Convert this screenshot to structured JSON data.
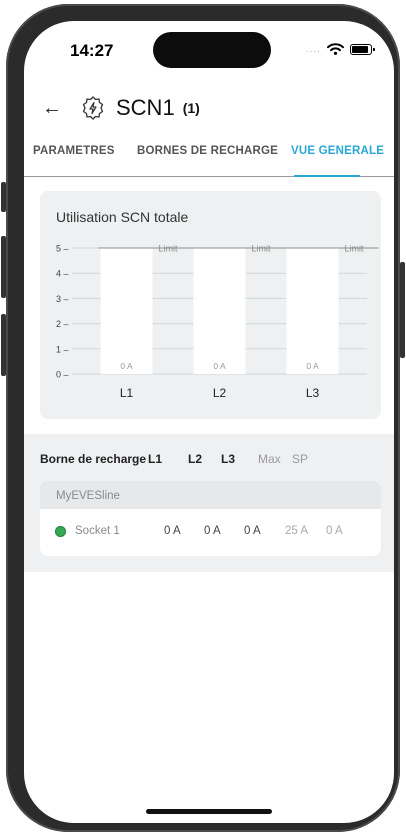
{
  "status_bar": {
    "time": "14:27",
    "signal_dots": "....",
    "wifi_icon": "wifi-icon",
    "battery_icon": "battery-icon"
  },
  "header": {
    "back_icon": "arrow-left-icon",
    "device_icon": "ev-charger-icon",
    "title": "SCN1",
    "count": "(1)"
  },
  "tabs": [
    {
      "label": "PARAMETRES",
      "active": false
    },
    {
      "label": "BORNES DE RECHARGE",
      "active": false
    },
    {
      "label": "VUE GENERALE",
      "active": true
    }
  ],
  "accent_color": "#29a7d6",
  "chart": {
    "title": "Utilisation SCN totale"
  },
  "chart_data": {
    "type": "bar",
    "title": "Utilisation SCN totale",
    "categories": [
      "L1",
      "L2",
      "L3"
    ],
    "values": [
      0,
      0,
      0
    ],
    "value_labels": [
      "0 A",
      "0 A",
      "0 A"
    ],
    "limit_label": "Limit",
    "limit_value": 5,
    "y_ticks": [
      0,
      1,
      2,
      3,
      4,
      5
    ],
    "ylim": [
      0,
      5
    ],
    "grid": true,
    "legend": "none"
  },
  "table": {
    "headers": [
      "Borne de recharge",
      "L1",
      "L2",
      "L3",
      "Max",
      "SP"
    ],
    "group": "MyEVESline",
    "rows": [
      {
        "status_color": "#34a853",
        "name": "Socket 1",
        "l1": "0 A",
        "l2": "0 A",
        "l3": "0 A",
        "max": "25 A",
        "sp": "0 A"
      }
    ]
  }
}
